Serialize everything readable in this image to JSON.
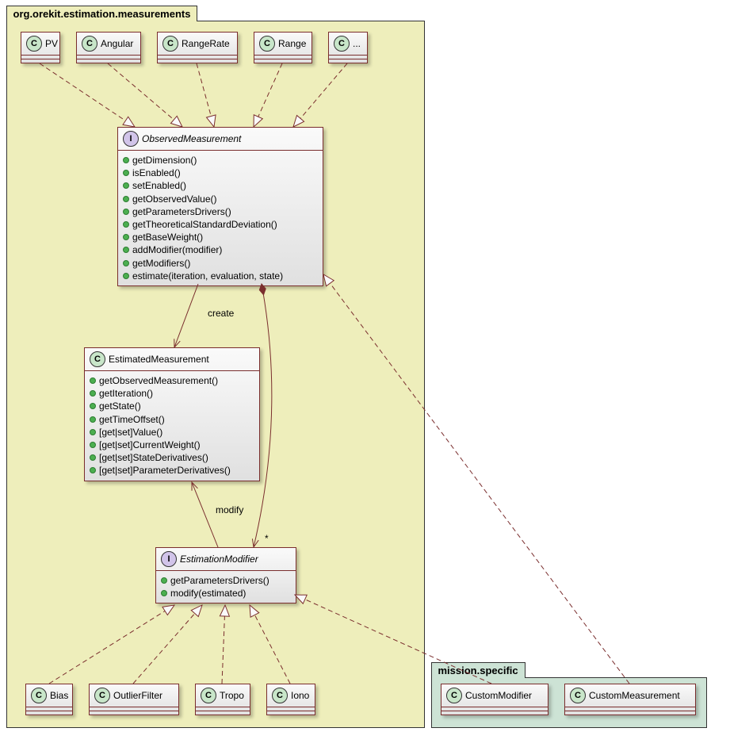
{
  "packages": {
    "orekit": {
      "name": "org.orekit.estimation.measurements"
    },
    "mission": {
      "name": "mission.specific"
    }
  },
  "classes": {
    "pv": {
      "name": "PV",
      "stereotype": "C"
    },
    "angular": {
      "name": "Angular",
      "stereotype": "C"
    },
    "rangerate": {
      "name": "RangeRate",
      "stereotype": "C"
    },
    "range": {
      "name": "Range",
      "stereotype": "C"
    },
    "dots": {
      "name": "...",
      "stereotype": "C"
    },
    "observed": {
      "name": "ObservedMeasurement",
      "stereotype": "I",
      "members": [
        "getDimension()",
        "isEnabled()",
        "setEnabled()",
        "getObservedValue()",
        "getParametersDrivers()",
        "getTheoreticalStandardDeviation()",
        "getBaseWeight()",
        "addModifier(modifier)",
        "getModifiers()",
        "estimate(iteration, evaluation, state)"
      ]
    },
    "estimated": {
      "name": "EstimatedMeasurement",
      "stereotype": "C",
      "members": [
        "getObservedMeasurement()",
        "getIteration()",
        "getState()",
        "getTimeOffset()",
        "[get|set]Value()",
        "[get|set]CurrentWeight()",
        "[get|set]StateDerivatives()",
        "[get|set]ParameterDerivatives()"
      ]
    },
    "modifier": {
      "name": "EstimationModifier",
      "stereotype": "I",
      "members": [
        "getParametersDrivers()",
        "modify(estimated)"
      ]
    },
    "bias": {
      "name": "Bias",
      "stereotype": "C"
    },
    "outlier": {
      "name": "OutlierFilter",
      "stereotype": "C"
    },
    "tropo": {
      "name": "Tropo",
      "stereotype": "C"
    },
    "iono": {
      "name": "Iono",
      "stereotype": "C"
    },
    "custommod": {
      "name": "CustomModifier",
      "stereotype": "C"
    },
    "custommeas": {
      "name": "CustomMeasurement",
      "stereotype": "C"
    }
  },
  "edges": {
    "create": {
      "label": "create"
    },
    "modify": {
      "label": "modify"
    },
    "star": {
      "label": "*"
    }
  },
  "chart_data": {
    "type": "uml-class-diagram",
    "packages": [
      {
        "name": "org.orekit.estimation.measurements",
        "elements": [
          {
            "kind": "class",
            "name": "PV"
          },
          {
            "kind": "class",
            "name": "Angular"
          },
          {
            "kind": "class",
            "name": "RangeRate"
          },
          {
            "kind": "class",
            "name": "Range"
          },
          {
            "kind": "class",
            "name": "..."
          },
          {
            "kind": "interface",
            "name": "ObservedMeasurement",
            "operations": [
              "getDimension()",
              "isEnabled()",
              "setEnabled()",
              "getObservedValue()",
              "getParametersDrivers()",
              "getTheoreticalStandardDeviation()",
              "getBaseWeight()",
              "addModifier(modifier)",
              "getModifiers()",
              "estimate(iteration, evaluation, state)"
            ]
          },
          {
            "kind": "class",
            "name": "EstimatedMeasurement",
            "operations": [
              "getObservedMeasurement()",
              "getIteration()",
              "getState()",
              "getTimeOffset()",
              "[get|set]Value()",
              "[get|set]CurrentWeight()",
              "[get|set]StateDerivatives()",
              "[get|set]ParameterDerivatives()"
            ]
          },
          {
            "kind": "interface",
            "name": "EstimationModifier",
            "operations": [
              "getParametersDrivers()",
              "modify(estimated)"
            ]
          },
          {
            "kind": "class",
            "name": "Bias"
          },
          {
            "kind": "class",
            "name": "OutlierFilter"
          },
          {
            "kind": "class",
            "name": "Tropo"
          },
          {
            "kind": "class",
            "name": "Iono"
          }
        ]
      },
      {
        "name": "mission.specific",
        "elements": [
          {
            "kind": "class",
            "name": "CustomModifier"
          },
          {
            "kind": "class",
            "name": "CustomMeasurement"
          }
        ]
      }
    ],
    "relationships": [
      {
        "from": "PV",
        "to": "ObservedMeasurement",
        "type": "realization"
      },
      {
        "from": "Angular",
        "to": "ObservedMeasurement",
        "type": "realization"
      },
      {
        "from": "RangeRate",
        "to": "ObservedMeasurement",
        "type": "realization"
      },
      {
        "from": "Range",
        "to": "ObservedMeasurement",
        "type": "realization"
      },
      {
        "from": "...",
        "to": "ObservedMeasurement",
        "type": "realization"
      },
      {
        "from": "CustomMeasurement",
        "to": "ObservedMeasurement",
        "type": "realization"
      },
      {
        "from": "ObservedMeasurement",
        "to": "EstimatedMeasurement",
        "type": "dependency",
        "label": "create"
      },
      {
        "from": "EstimationModifier",
        "to": "EstimatedMeasurement",
        "type": "dependency",
        "label": "modify"
      },
      {
        "from": "ObservedMeasurement",
        "to": "EstimationModifier",
        "type": "composition",
        "multiplicity_to": "*"
      },
      {
        "from": "Bias",
        "to": "EstimationModifier",
        "type": "realization"
      },
      {
        "from": "OutlierFilter",
        "to": "EstimationModifier",
        "type": "realization"
      },
      {
        "from": "Tropo",
        "to": "EstimationModifier",
        "type": "realization"
      },
      {
        "from": "Iono",
        "to": "EstimationModifier",
        "type": "realization"
      },
      {
        "from": "CustomModifier",
        "to": "EstimationModifier",
        "type": "realization"
      }
    ]
  }
}
